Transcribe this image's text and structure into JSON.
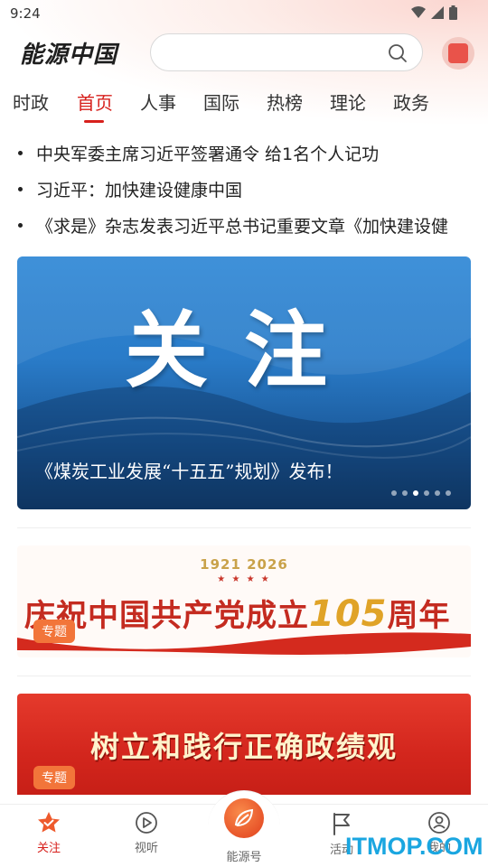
{
  "status": {
    "time": "9:24"
  },
  "header": {
    "logo": "能源中国",
    "search_placeholder": ""
  },
  "tabs": [
    {
      "label": "时政"
    },
    {
      "label": "首页"
    },
    {
      "label": "人事"
    },
    {
      "label": "国际"
    },
    {
      "label": "热榜"
    },
    {
      "label": "理论"
    },
    {
      "label": "政务"
    }
  ],
  "active_tab": "首页",
  "headlines": [
    "中央军委主席习近平签署通令 给1名个人记功",
    "习近平：加快建设健康中国",
    "《求是》杂志发表习近平总书记重要文章《加快建设健"
  ],
  "banner": {
    "big_text": "关注",
    "caption": "《煤炭工业发展“十五五”规划》发布！",
    "dots_total": 6,
    "active_dot": 3
  },
  "card1": {
    "years": "1921   2026",
    "stars": "★ ★ ★ ★",
    "title_prefix": "庆祝中国共产党成立",
    "title_number": "105",
    "title_suffix": "周年",
    "tag": "专题"
  },
  "card2": {
    "title": "树立和践行正确政绩观",
    "tag": "专题"
  },
  "bottom_nav": [
    {
      "label": "关注",
      "icon": "star-badge-icon",
      "active": true
    },
    {
      "label": "视听",
      "icon": "play-circle-icon",
      "active": false
    },
    {
      "label": "能源号",
      "icon": "leaf-icon",
      "active": false
    },
    {
      "label": "活动",
      "icon": "flag-icon",
      "active": false
    },
    {
      "label": "我的",
      "icon": "user-circle-icon",
      "active": false
    }
  ],
  "watermark": "ITMOP.COM",
  "colors": {
    "accent": "#d7201c",
    "tag": "#f2753a",
    "banner_blue": "#2a7cc9"
  }
}
